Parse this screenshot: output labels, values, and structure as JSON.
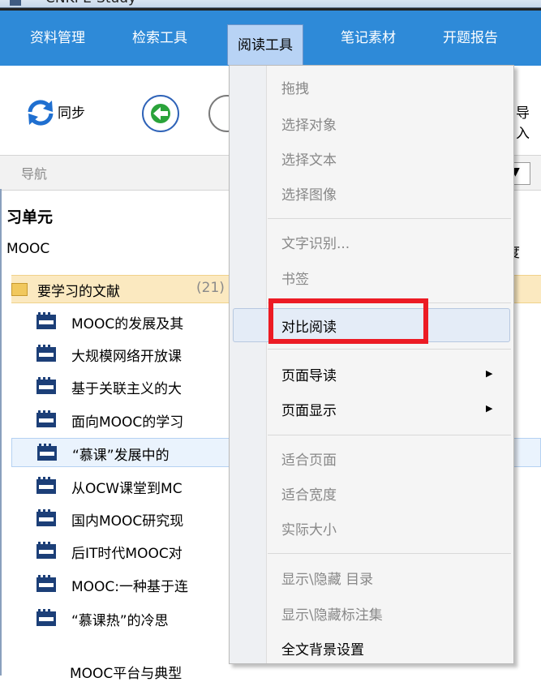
{
  "window": {
    "title": "CNKI E-Study"
  },
  "menubar": {
    "items": [
      {
        "label": "资料管理"
      },
      {
        "label": "检索工具"
      },
      {
        "label": "阅读工具"
      },
      {
        "label": "笔记素材"
      },
      {
        "label": "开题报告"
      }
    ],
    "active_index": 2
  },
  "toolbar": {
    "sync_label": "同步",
    "import_label_partial": "导入"
  },
  "nav": {
    "header_label": "导航",
    "unit_title_partial": "习单元",
    "unit_subtitle": "MOOC",
    "column_header_partial": "度",
    "folder": {
      "label": "要学习的文献",
      "count": "(21)"
    },
    "docs": [
      "MOOC的发展及其",
      "大规模网络开放课",
      "基于关联主义的大",
      "面向MOOC的学习",
      "“慕课”发展中的",
      "从OCW课堂到MC",
      "国内MOOC研究现",
      "后IT时代MOOC对",
      "MOOC:一种基于连",
      "“慕课热”的冷思"
    ],
    "last_row_partial": "MOOC平台与典型"
  },
  "dropdown": {
    "items": [
      {
        "label": "拖拽",
        "enabled": false
      },
      {
        "label": "选择对象",
        "enabled": false
      },
      {
        "label": "选择文本",
        "enabled": false
      },
      {
        "label": "选择图像",
        "enabled": false
      },
      {
        "label": "文字识别...",
        "enabled": false
      },
      {
        "label": "书签",
        "enabled": false
      },
      {
        "label": "对比阅读",
        "enabled": true,
        "highlighted": true
      },
      {
        "label": "页面导读",
        "enabled": true,
        "submenu": true
      },
      {
        "label": "页面显示",
        "enabled": true,
        "submenu": true
      },
      {
        "label": "适合页面",
        "enabled": false
      },
      {
        "label": "适合宽度",
        "enabled": false
      },
      {
        "label": "实际大小",
        "enabled": false
      },
      {
        "label": "显示\\隐藏 目录",
        "enabled": false
      },
      {
        "label": "显示\\隐藏标注集",
        "enabled": false
      },
      {
        "label": "全文背景设置",
        "enabled": true
      }
    ]
  },
  "colors": {
    "menubar_bg": "#2e8ad8",
    "active_menu_bg": "#b8d3f5",
    "annotation_red": "#ec1b24",
    "folder_bg": "#fbe9c0"
  },
  "icons": [
    "sync-icon",
    "back-arrow-icon",
    "folder-icon",
    "caj-document-icon",
    "submenu-arrow-icon"
  ]
}
